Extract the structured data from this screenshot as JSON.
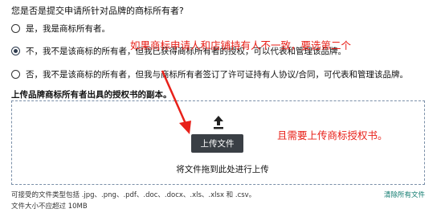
{
  "question": {
    "text": "您是否是提交申请所针对品牌的商标所有者?"
  },
  "options": [
    {
      "label": "是，我是商标所有者。",
      "checked": false
    },
    {
      "label": "不，我不是该商标的所有者，但我已获得商标所有者的授权，可以代表和管理该品牌。",
      "checked": true
    },
    {
      "label": "否，我不是该商标的所有者，但我与商标所有者签订了许可证持有人协议/合同，可代表和管理该品牌。",
      "checked": false
    }
  ],
  "upload": {
    "section_label": "上传品牌商标所有者出具的授权书的副本。",
    "button_label": "上传文件",
    "drag_hint": "将文件拖到此处进行上传",
    "accepted_types": "可接受的文件类型包括 .jpg、.png、.pdf、.doc、.docx、.xls、.xlsx 和 .csv。",
    "max_size": "文件大小不应超过 10MB",
    "clear_all_label": "清除所有文件"
  },
  "annotations": {
    "note1": "如果商标申请人和店铺持有人不一致，要选第二个",
    "note2": "且需要上传商标授权书。",
    "color": "#e8211a"
  },
  "colors": {
    "button_bg": "#3a3f45",
    "link": "#0f7a6e",
    "dashed_border": "#7a8fa8"
  }
}
